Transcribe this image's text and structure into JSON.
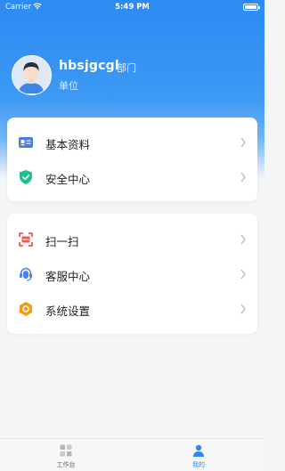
{
  "status_bar": {
    "carrier": "Carrier",
    "time": "5:49 PM"
  },
  "profile": {
    "username": "hbsjgcgl",
    "department": "部门",
    "unit": "单位"
  },
  "menu_group_1": [
    {
      "label": "基本资料",
      "icon": "id-card-icon"
    },
    {
      "label": "安全中心",
      "icon": "shield-check-icon"
    }
  ],
  "menu_group_2": [
    {
      "label": "扫一扫",
      "icon": "scan-icon"
    },
    {
      "label": "客服中心",
      "icon": "headset-icon"
    },
    {
      "label": "系统设置",
      "icon": "settings-hexagon-icon"
    }
  ],
  "tab_bar": [
    {
      "label": "工作台",
      "icon": "grid-icon",
      "active": false
    },
    {
      "label": "我的",
      "icon": "person-icon",
      "active": true
    }
  ],
  "colors": {
    "primary": "#2c8af2",
    "shield_green": "#1fbf8f",
    "scan_red": "#f0584b",
    "settings_orange": "#f39c12",
    "id_card_blue": "#4d7be8",
    "headset_blue": "#4a7ff0"
  }
}
